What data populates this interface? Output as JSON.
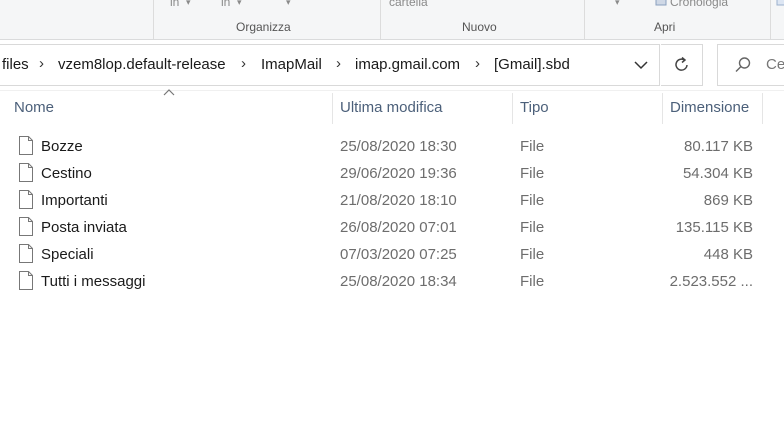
{
  "ribbon": {
    "fragments": [
      "in",
      "in",
      "cartella",
      "Cronologia"
    ],
    "groups": [
      "Organizza",
      "Nuovo",
      "Apri"
    ]
  },
  "address": {
    "crumbs": [
      "files",
      "vzem8lop.default-release",
      "ImapMail",
      "imap.gmail.com",
      "[Gmail].sbd"
    ],
    "search_placeholder": "Ce"
  },
  "columns": {
    "name": "Nome",
    "modified": "Ultima modifica",
    "type": "Tipo",
    "size": "Dimensione"
  },
  "files": [
    {
      "name": "Bozze",
      "modified": "25/08/2020 18:30",
      "type": "File",
      "size": "80.117 KB"
    },
    {
      "name": "Cestino",
      "modified": "29/06/2020 19:36",
      "type": "File",
      "size": "54.304 KB"
    },
    {
      "name": "Importanti",
      "modified": "21/08/2020 18:10",
      "type": "File",
      "size": "869 KB"
    },
    {
      "name": "Posta inviata",
      "modified": "26/08/2020 07:01",
      "type": "File",
      "size": "135.115 KB"
    },
    {
      "name": "Speciali",
      "modified": "07/03/2020 07:25",
      "type": "File",
      "size": "448 KB"
    },
    {
      "name": "Tutti i messaggi",
      "modified": "25/08/2020 18:34",
      "type": "File",
      "size": "2.523.552 ..."
    }
  ]
}
